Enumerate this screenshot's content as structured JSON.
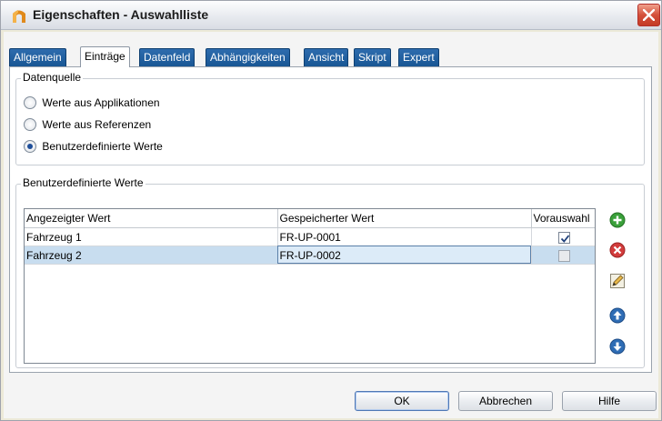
{
  "window": {
    "title": "Eigenschaften - Auswahlliste"
  },
  "tabs": [
    {
      "label": "Allgemein"
    },
    {
      "label": "Einträge",
      "active": true
    },
    {
      "label": "Datenfeld"
    },
    {
      "label": "Abhängigkeiten"
    },
    {
      "label": "Ansicht"
    },
    {
      "label": "Skript"
    },
    {
      "label": "Expert"
    }
  ],
  "datenquelle": {
    "legend": "Datenquelle",
    "options": [
      {
        "label": "Werte aus Applikationen",
        "checked": false
      },
      {
        "label": "Werte aus Referenzen",
        "checked": false
      },
      {
        "label": "Benutzerdefinierte Werte",
        "checked": true
      }
    ]
  },
  "custom_values": {
    "legend": "Benutzerdefinierte Werte",
    "columns": [
      "Angezeigter Wert",
      "Gespeicherter Wert",
      "Vorauswahl"
    ],
    "rows": [
      {
        "display": "Fahrzeug 1",
        "stored": "FR-UP-0001",
        "preselected": true
      },
      {
        "display": "Fahrzeug 2",
        "stored": "FR-UP-0002",
        "preselected": false
      }
    ],
    "side_buttons": [
      "add-icon",
      "delete-icon",
      "edit-icon",
      "move-up-icon",
      "move-down-icon"
    ]
  },
  "footer": {
    "ok_label": "OK",
    "cancel_label": "Abbrechen",
    "help_label": "Hilfe"
  },
  "colors": {
    "tab_background": "#185694",
    "selected_row": "#c8ddef",
    "add_green": "#3aa03a",
    "delete_red": "#d23c3c",
    "arrow_blue": "#2f6db5"
  }
}
